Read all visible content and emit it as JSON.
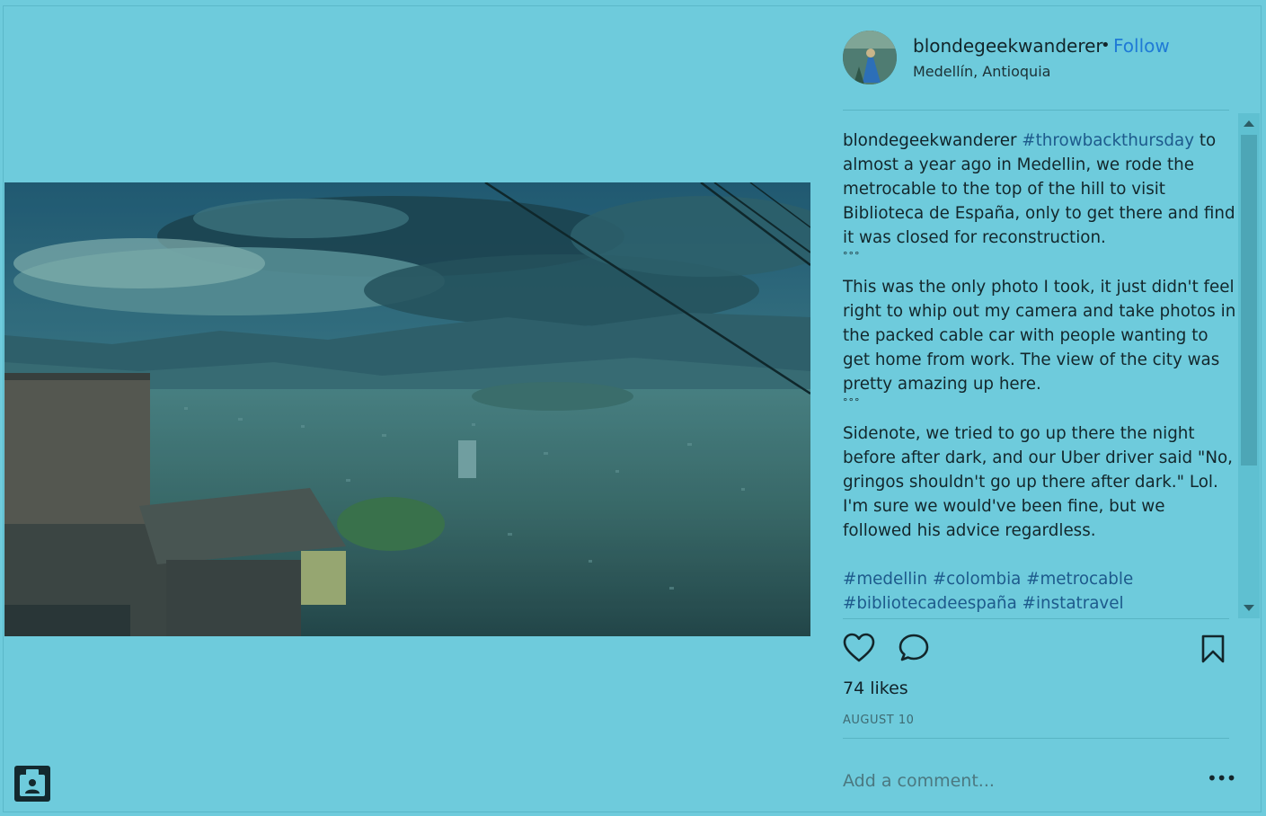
{
  "post": {
    "username": "blondegeekwanderer",
    "separator": "•",
    "follow_label": "Follow",
    "location": "Medellín, Antioquia",
    "likes": "74 likes",
    "date": "AUGUST 10",
    "comment_placeholder": "Add a comment...",
    "more_label": "•••"
  },
  "caption": {
    "username": "blondegeekwanderer",
    "hashtag_first": "#throwbackthursday",
    "para1": "to almost a year ago in Medellin, we rode the metrocable to the top of the hill to visit Biblioteca de España, only to get there and find it was closed for reconstruction.",
    "divider1": "°°°",
    "para2": "This was the only photo I took, it just didn't feel right to whip out my camera and take photos in the packed cable car with people wanting to get home from work. The view of the city was pretty amazing up here.",
    "divider2": "°°°",
    "para3": "Sidenote, we tried to go up there the night before after dark, and our Uber driver said \"No, gringos shouldn't go up there after dark.\" Lol. I'm sure we would've been fine, but we followed his advice regardless.",
    "hashtags": "#medellin #colombia #metrocable #bibliotecadeespaña #instatravel"
  },
  "icons": {
    "like": "heart-icon",
    "comment": "comment-bubble-icon",
    "save": "bookmark-icon",
    "corner": "profile-badge-icon"
  },
  "colors": {
    "background": "#6ecbdc",
    "link": "#1f7ad6",
    "hashtag": "#1d5a8c"
  }
}
